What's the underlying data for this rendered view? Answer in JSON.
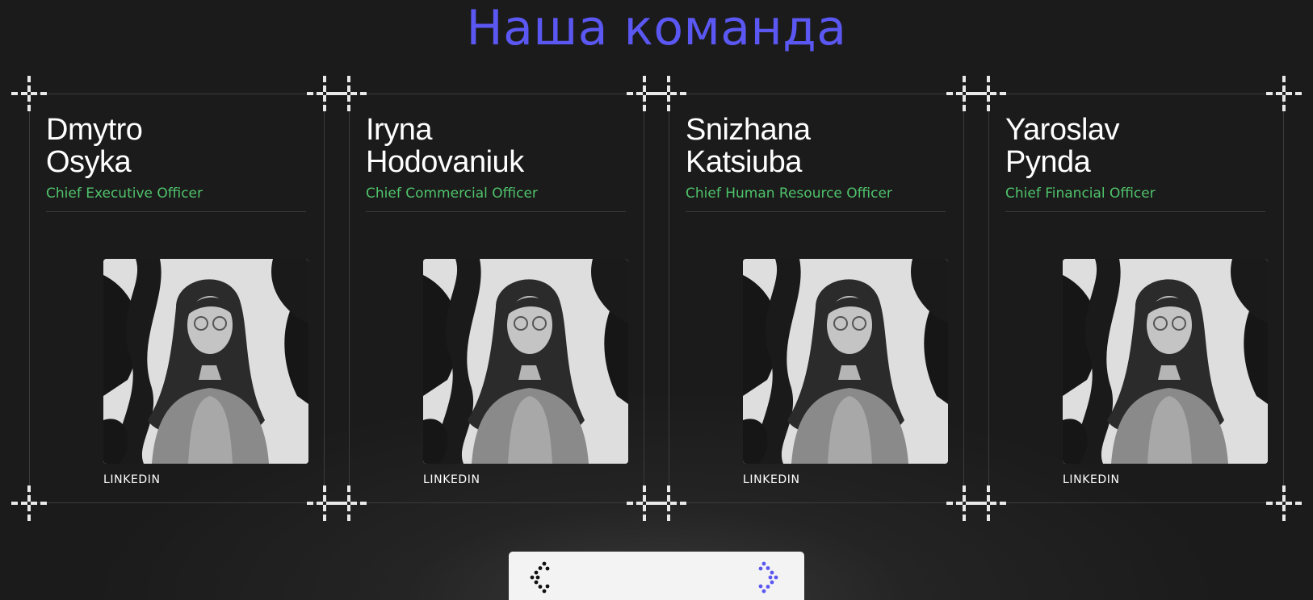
{
  "section": {
    "title": "Наша команда"
  },
  "team": [
    {
      "first_name": "Dmytro",
      "last_name": "Osyka",
      "role": "Chief Executive Officer",
      "link_label": "LINKEDIN"
    },
    {
      "first_name": "Iryna",
      "last_name": "Hodovaniuk",
      "role": "Chief Commercial Officer",
      "link_label": "LINKEDIN"
    },
    {
      "first_name": "Snizhana",
      "last_name": "Katsiuba",
      "role": "Chief Human Resource Officer",
      "link_label": "LINKEDIN"
    },
    {
      "first_name": "Yaroslav",
      "last_name": "Pynda",
      "role": "Chief Financial Officer",
      "link_label": "LINKEDIN"
    }
  ],
  "navigation": {
    "prev_icon": "chevron-left-icon",
    "next_icon": "chevron-right-icon"
  },
  "colors": {
    "accent": "#5b57f2",
    "role": "#4fc36b",
    "background": "#1b1b1b",
    "line": "#3c3c3c"
  }
}
